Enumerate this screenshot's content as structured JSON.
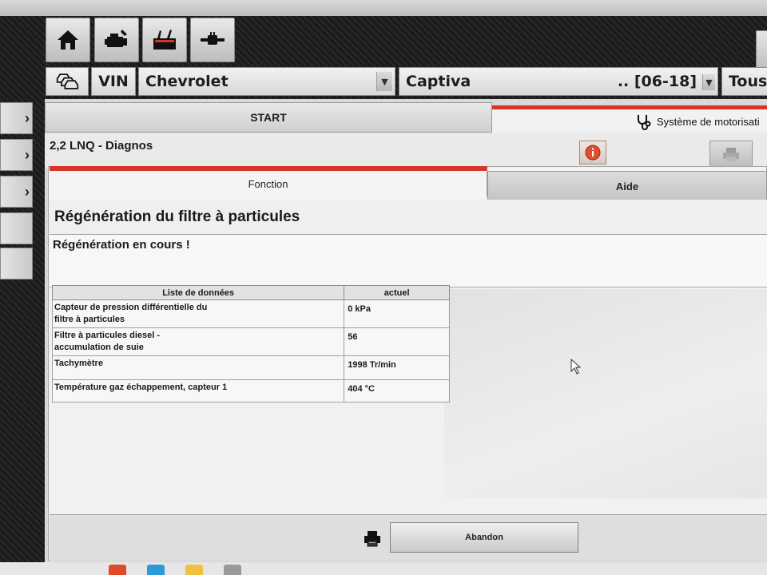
{
  "toolbar": {
    "icons": [
      "home-icon",
      "engine-diagnostic-icon",
      "toolbox-icon",
      "connector-icon"
    ]
  },
  "selectors": {
    "vehicles_icon": "cars-icon",
    "vin_label": "VIN",
    "brand": "Chevrolet",
    "model": "Captiva",
    "years": ".. [06-18]",
    "scope": "Tous"
  },
  "tabs": {
    "start": "START",
    "system": "Système de motorisati"
  },
  "breadcrumb": "2,2 LNQ - Diagnos",
  "subtabs": {
    "fonction": "Fonction",
    "aide": "Aide"
  },
  "function_title": "Régénération du filtre à particules",
  "status": "Régénération en cours !",
  "data_table": {
    "headers": [
      "Liste de données",
      "actuel"
    ],
    "rows": [
      {
        "name_line1": "Capteur de pression différentielle du",
        "name_line2": "filtre à particules",
        "value": "0 kPa"
      },
      {
        "name_line1": "Filtre à particules diesel -",
        "name_line2": "accumulation de suie",
        "value": "56"
      },
      {
        "name_line1": "Tachymètre",
        "name_line2": "",
        "value": "1998 Tr/min"
      },
      {
        "name_line1": "Température gaz échappement, capteur 1",
        "name_line2": "",
        "value": "404 °C"
      }
    ]
  },
  "buttons": {
    "abandon": "Abandon"
  },
  "colors": {
    "accent_red": "#d8352a"
  }
}
